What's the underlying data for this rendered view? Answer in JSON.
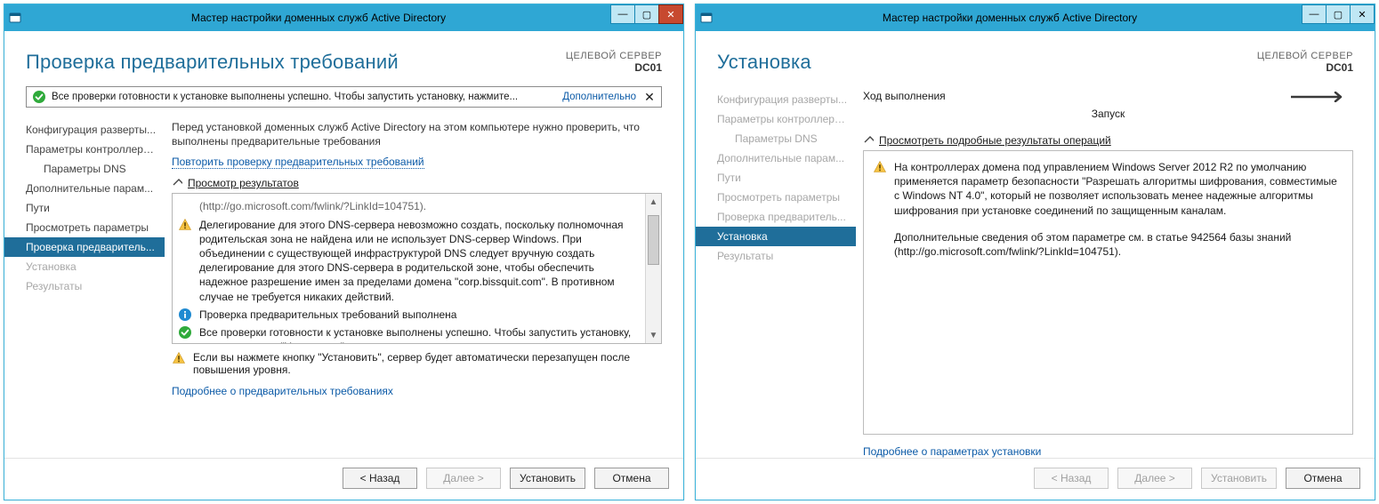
{
  "left": {
    "window_title": "Мастер настройки доменных служб Active Directory",
    "page_title": "Проверка предварительных требований",
    "target_label": "ЦЕЛЕВОЙ СЕРВЕР",
    "target_name": "DC01",
    "status_msg": "Все проверки готовности к установке выполнены успешно. Чтобы запустить установку, нажмите...",
    "status_more": "Дополнительно",
    "nav": [
      {
        "label": "Конфигурация разверты...",
        "disabled": false,
        "selected": false,
        "indent": false
      },
      {
        "label": "Параметры контроллера...",
        "disabled": false,
        "selected": false,
        "indent": false
      },
      {
        "label": "Параметры DNS",
        "disabled": false,
        "selected": false,
        "indent": true
      },
      {
        "label": "Дополнительные парам...",
        "disabled": false,
        "selected": false,
        "indent": false
      },
      {
        "label": "Пути",
        "disabled": false,
        "selected": false,
        "indent": false
      },
      {
        "label": "Просмотреть параметры",
        "disabled": false,
        "selected": false,
        "indent": false
      },
      {
        "label": "Проверка предваритель...",
        "disabled": false,
        "selected": true,
        "indent": false
      },
      {
        "label": "Установка",
        "disabled": true,
        "selected": false,
        "indent": false
      },
      {
        "label": "Результаты",
        "disabled": true,
        "selected": false,
        "indent": false
      }
    ],
    "intro": "Перед установкой доменных служб Active Directory на этом компьютере нужно проверить, что выполнены предварительные требования",
    "rerun_link": "Повторить проверку предварительных требований",
    "expander_label": "Просмотр результатов",
    "results": {
      "truncated_url": "(http://go.microsoft.com/fwlink/?LinkId=104751).",
      "warn1": "Делегирование для этого DNS-сервера невозможно создать, поскольку полномочная родительская зона не найдена или не использует DNS-сервер Windows. При объединении с существующей инфраструктурой DNS следует вручную создать делегирование для этого DNS-сервера в родительской зоне, чтобы обеспечить надежное разрешение имен за пределами домена \"corp.bissquit.com\". В противном случае не требуется никаких действий.",
      "info1": "Проверка предварительных требований выполнена",
      "ok1": "Все проверки готовности к установке выполнены успешно. Чтобы запустить установку, нажмите кнопку \"Установить\"."
    },
    "note": "Если вы нажмете кнопку \"Установить\", сервер будет автоматически перезапущен после повышения уровня.",
    "more_info": "Подробнее о предварительных требованиях",
    "buttons": {
      "back": "< Назад",
      "next": "Далее >",
      "install": "Установить",
      "cancel": "Отмена"
    }
  },
  "right": {
    "window_title": "Мастер настройки доменных служб Active Directory",
    "page_title": "Установка",
    "target_label": "ЦЕЛЕВОЙ СЕРВЕР",
    "target_name": "DC01",
    "section_title": "Ход выполнения",
    "phase_label": "Запуск",
    "expander_label": "Просмотреть подробные результаты операций",
    "nav": [
      {
        "label": "Конфигурация разверты...",
        "disabled": true,
        "selected": false,
        "indent": false
      },
      {
        "label": "Параметры контроллера...",
        "disabled": true,
        "selected": false,
        "indent": false
      },
      {
        "label": "Параметры DNS",
        "disabled": true,
        "selected": false,
        "indent": true
      },
      {
        "label": "Дополнительные парам...",
        "disabled": true,
        "selected": false,
        "indent": false
      },
      {
        "label": "Пути",
        "disabled": true,
        "selected": false,
        "indent": false
      },
      {
        "label": "Просмотреть параметры",
        "disabled": true,
        "selected": false,
        "indent": false
      },
      {
        "label": "Проверка предваритель...",
        "disabled": true,
        "selected": false,
        "indent": false
      },
      {
        "label": "Установка",
        "disabled": false,
        "selected": true,
        "indent": false
      },
      {
        "label": "Результаты",
        "disabled": true,
        "selected": false,
        "indent": false
      }
    ],
    "warn_text": "На контроллерах домена под управлением Windows Server 2012 R2 по умолчанию применяется параметр безопасности \"Разрешать алгоритмы шифрования, совместимые с Windows NT 4.0\", который не позволяет использовать менее надежные алгоритмы шифрования при установке соединений по защищенным каналам.",
    "extra_text": "Дополнительные сведения об этом параметре см. в статье 942564 базы знаний (http://go.microsoft.com/fwlink/?LinkId=104751).",
    "more_info": "Подробнее о параметрах установки",
    "buttons": {
      "back": "< Назад",
      "next": "Далее >",
      "install": "Установить",
      "cancel": "Отмена"
    }
  }
}
